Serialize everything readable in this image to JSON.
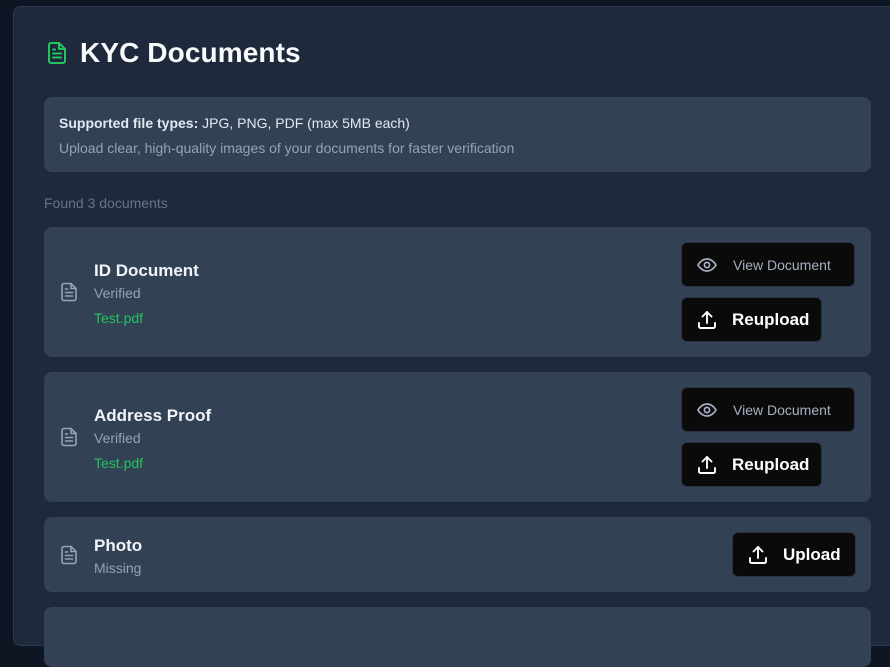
{
  "page": {
    "title": "KYC Documents"
  },
  "info": {
    "supported_label": "Supported file types:",
    "supported_value": " JPG, PNG, PDF (max 5MB each)",
    "hint": "Upload clear, high-quality images of your documents for faster verification"
  },
  "found_text": "Found 3 documents",
  "documents": [
    {
      "name": "ID Document",
      "status": "Verified",
      "file": "Test.pdf",
      "view_label": "View Document",
      "action_label": "Reupload"
    },
    {
      "name": "Address Proof",
      "status": "Verified",
      "file": "Test.pdf",
      "view_label": "View Document",
      "action_label": "Reupload"
    },
    {
      "name": "Photo",
      "status": "Missing",
      "action_label": "Upload"
    }
  ],
  "icons": {
    "header": "document-icon",
    "file": "file-text-icon",
    "view": "eye-icon",
    "upload": "upload-icon"
  },
  "colors": {
    "accent": "#22c55e",
    "panel": "#1e293b",
    "card": "#334155",
    "button": "#0a0a0b"
  }
}
